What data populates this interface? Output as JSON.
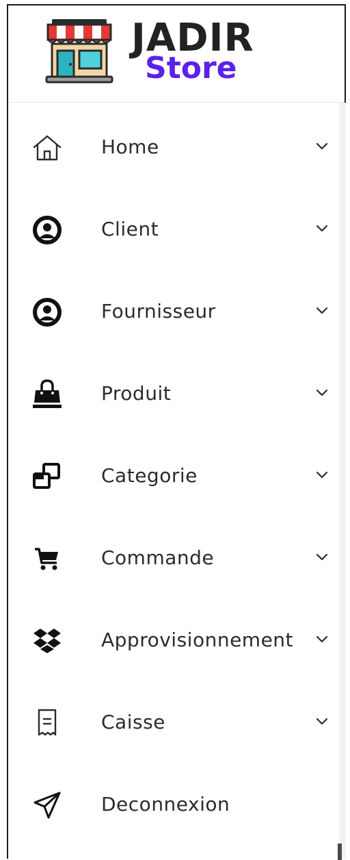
{
  "brand": {
    "line1": "JADIR",
    "line2": "Store",
    "primary_color": "#222222",
    "accent_color": "#5b21ea",
    "icon": "store-shop-icon"
  },
  "sidebar": {
    "items": [
      {
        "label": "Home",
        "icon": "house-icon",
        "has_submenu": true
      },
      {
        "label": "Client",
        "icon": "user-circle-icon",
        "has_submenu": true
      },
      {
        "label": "Fournisseur",
        "icon": "user-circle-icon",
        "has_submenu": true
      },
      {
        "label": "Produit",
        "icon": "shopping-bag-icon",
        "has_submenu": true
      },
      {
        "label": "Categorie",
        "icon": "clone-squares-icon",
        "has_submenu": true
      },
      {
        "label": "Commande",
        "icon": "shopping-cart-icon",
        "has_submenu": true
      },
      {
        "label": "Approvisionnement",
        "icon": "dropbox-icon",
        "has_submenu": true
      },
      {
        "label": "Caisse",
        "icon": "receipt-icon",
        "has_submenu": true
      },
      {
        "label": "Deconnexion",
        "icon": "paper-plane-icon",
        "has_submenu": false
      }
    ]
  }
}
